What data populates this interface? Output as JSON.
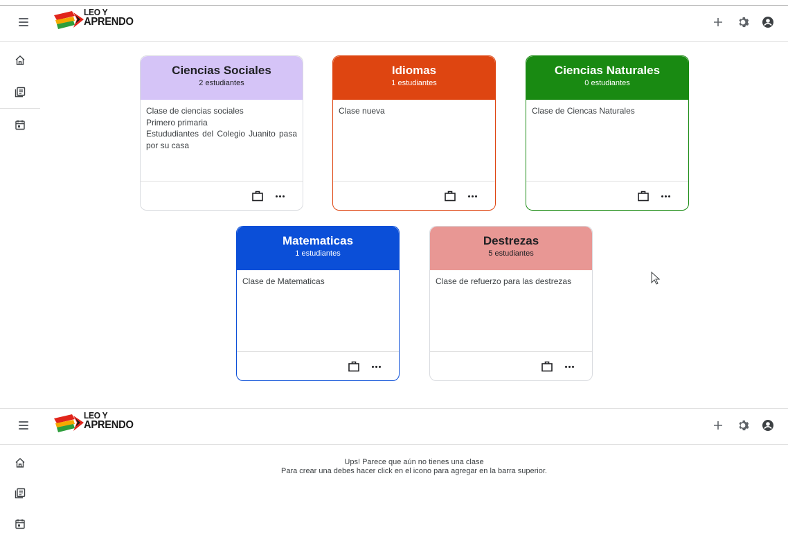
{
  "app": {
    "logo_text_line1": "LEO Y",
    "logo_text_line2": "APRENDO",
    "topbar_icons": [
      "add-icon",
      "settings-icon",
      "account-icon"
    ],
    "sidebar_icons": [
      "home-icon",
      "classes-icon",
      "calendar-icon"
    ]
  },
  "colors": {
    "ciencias_sociales": "#d5c4f7",
    "idiomas": "#de4511",
    "ciencias_naturales": "#198a12",
    "matematicas": "#0b4fd8",
    "destrezas": "#e89794"
  },
  "classes": [
    {
      "title": "Ciencias Sociales",
      "count": "2 estudiantes",
      "description": [
        "Clase de ciencias sociales",
        "Primero primaria",
        "Estududiantes del Colegio Juanito pasa por su casa"
      ]
    },
    {
      "title": "Idiomas",
      "count": "1 estudiantes",
      "description": [
        "Clase nueva"
      ]
    },
    {
      "title": "Ciencias Naturales",
      "count": "0 estudiantes",
      "description": [
        "Clase de Ciencas Naturales"
      ]
    },
    {
      "title": "Matematicas",
      "count": "1 estudiantes",
      "description": [
        "Clase de Matematicas"
      ]
    },
    {
      "title": "Destrezas",
      "count": "5 estudiantes",
      "description": [
        "Clase de refuerzo para las destrezas"
      ]
    }
  ],
  "empty_state": {
    "line1": "Ups! Parece que aún no tienes una clase",
    "line2": "Para crear una debes hacer click en el icono para agregar en la barra superior."
  }
}
